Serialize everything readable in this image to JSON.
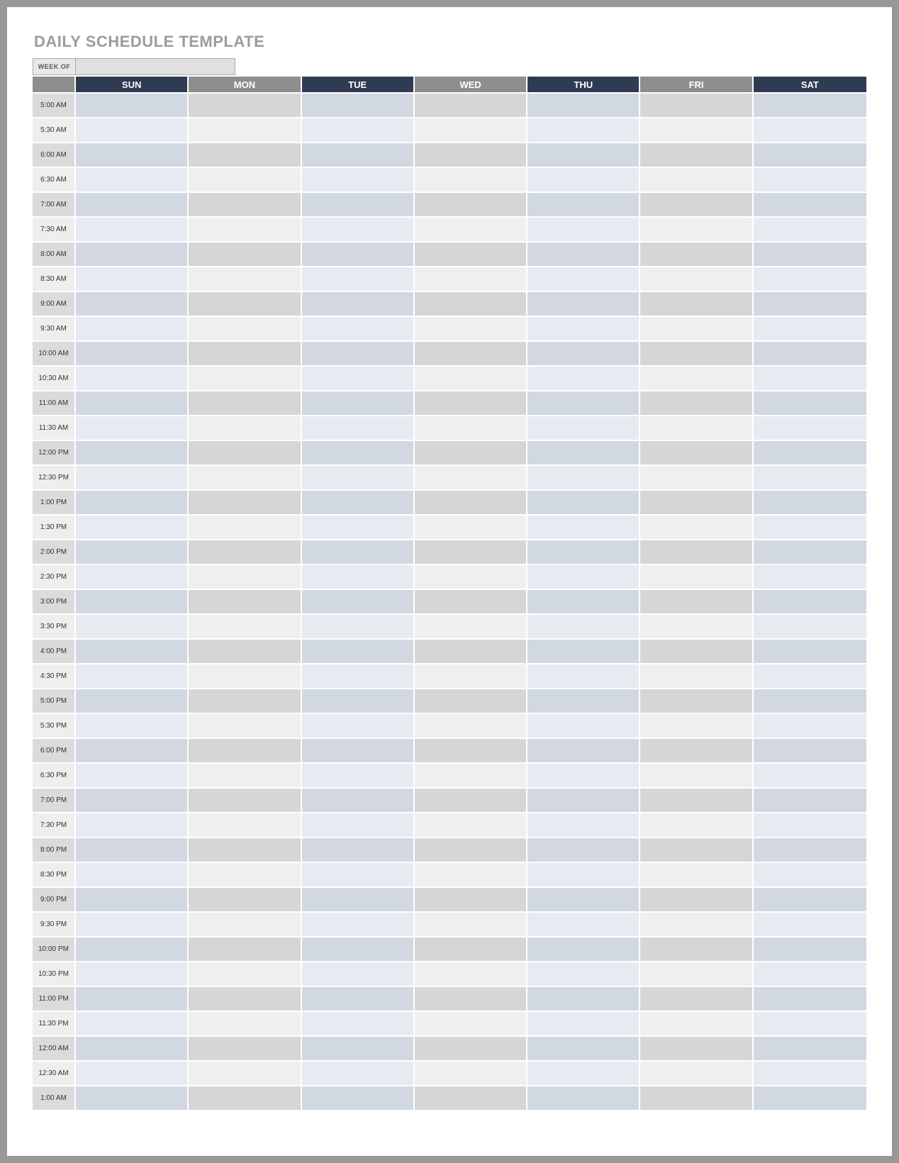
{
  "title": "DAILY SCHEDULE TEMPLATE",
  "weekof": {
    "label": "WEEK OF",
    "value": ""
  },
  "days": [
    {
      "key": "sun",
      "label": "SUN",
      "family": "navy"
    },
    {
      "key": "mon",
      "label": "MON",
      "family": "grey"
    },
    {
      "key": "tue",
      "label": "TUE",
      "family": "navy"
    },
    {
      "key": "wed",
      "label": "WED",
      "family": "grey"
    },
    {
      "key": "thu",
      "label": "THU",
      "family": "navy"
    },
    {
      "key": "fri",
      "label": "FRI",
      "family": "grey"
    },
    {
      "key": "sat",
      "label": "SAT",
      "family": "navy"
    }
  ],
  "times": [
    "5:00 AM",
    "5:30 AM",
    "6:00 AM",
    "6:30 AM",
    "7:00 AM",
    "7:30 AM",
    "8:00 AM",
    "8:30 AM",
    "9:00 AM",
    "9:30 AM",
    "10:00 AM",
    "10:30 AM",
    "11:00 AM",
    "11:30 AM",
    "12:00 PM",
    "12:30 PM",
    "1:00 PM",
    "1:30 PM",
    "2:00 PM",
    "2:30 PM",
    "3:00 PM",
    "3:30 PM",
    "4:00 PM",
    "4:30 PM",
    "5:00 PM",
    "5:30 PM",
    "6:00 PM",
    "6:30 PM",
    "7:00 PM",
    "7:30 PM",
    "8:00 PM",
    "8:30 PM",
    "9:00 PM",
    "9:30 PM",
    "10:00 PM",
    "10:30 PM",
    "11:00 PM",
    "11:30 PM",
    "12:00 AM",
    "12:30 AM",
    "1:00 AM"
  ],
  "cells": {}
}
